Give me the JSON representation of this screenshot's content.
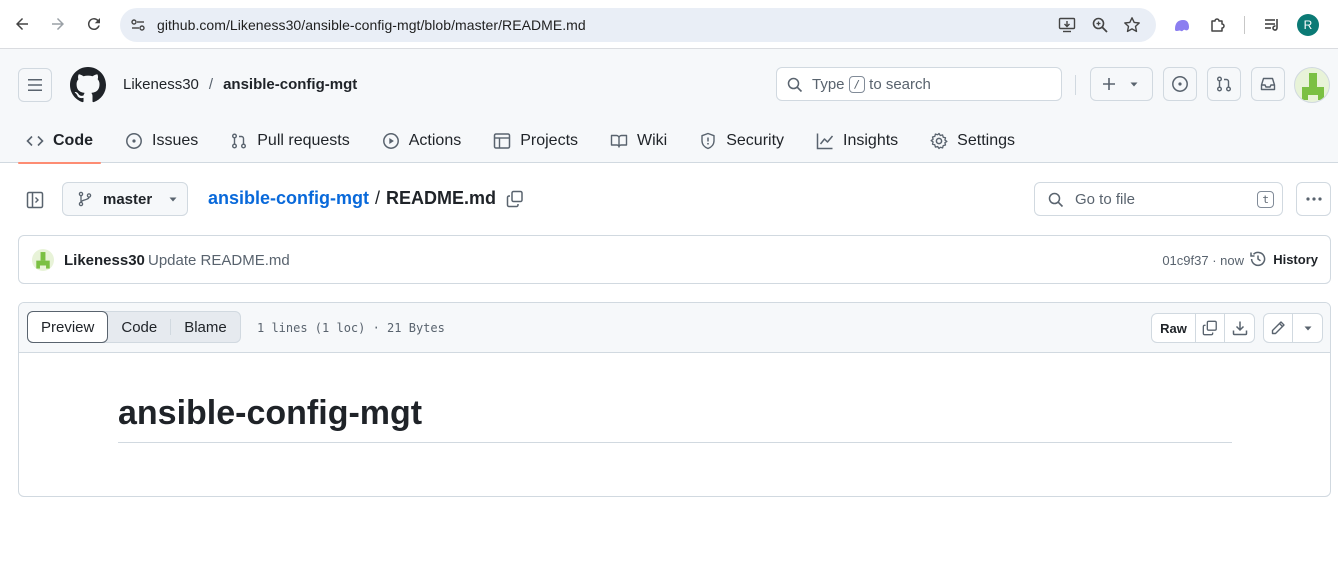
{
  "browser": {
    "url": "github.com/Likeness30/ansible-config-mgt/blob/master/README.md",
    "profile_initial": "R"
  },
  "header": {
    "owner": "Likeness30",
    "separator": "/",
    "repo": "ansible-config-mgt",
    "search_prefix": "Type",
    "search_key": "/",
    "search_suffix": "to search"
  },
  "tabs": [
    {
      "label": "Code",
      "icon": "code-icon",
      "selected": true
    },
    {
      "label": "Issues",
      "icon": "issue-icon"
    },
    {
      "label": "Pull requests",
      "icon": "pull-request-icon"
    },
    {
      "label": "Actions",
      "icon": "play-icon"
    },
    {
      "label": "Projects",
      "icon": "table-icon"
    },
    {
      "label": "Wiki",
      "icon": "book-icon"
    },
    {
      "label": "Security",
      "icon": "shield-icon"
    },
    {
      "label": "Insights",
      "icon": "graph-icon"
    },
    {
      "label": "Settings",
      "icon": "gear-icon"
    }
  ],
  "file_nav": {
    "branch": "master",
    "breadcrumb_repo": "ansible-config-mgt",
    "breadcrumb_sep": "/",
    "breadcrumb_file": "README.md",
    "goto_placeholder": "Go to file",
    "goto_key": "t"
  },
  "commit": {
    "author": "Likeness30",
    "message": "Update README.md",
    "meta": "01c9f37 · now",
    "history_label": "History"
  },
  "file_view": {
    "modes": [
      "Preview",
      "Code",
      "Blame"
    ],
    "active_mode": "Preview",
    "info": "1 lines (1 loc) · 21 Bytes",
    "raw_label": "Raw"
  },
  "readme": {
    "heading": "ansible-config-mgt"
  },
  "colors": {
    "link": "#0969da",
    "selected_tab_underline": "#fd8c73",
    "border": "#d1d9e0"
  }
}
